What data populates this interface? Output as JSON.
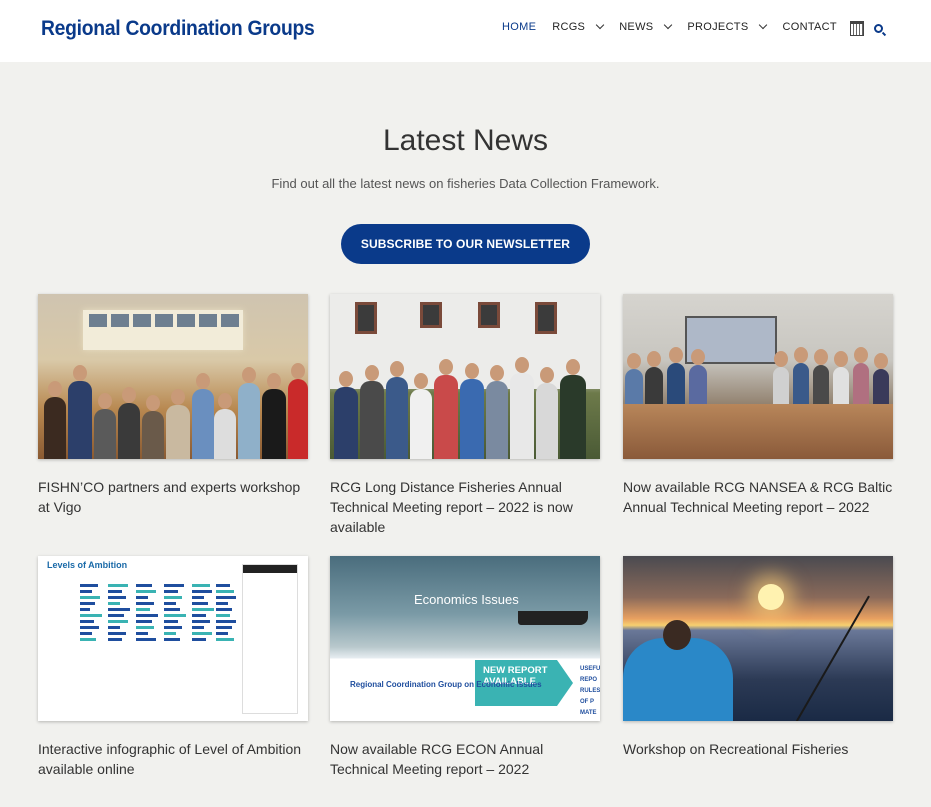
{
  "header": {
    "logo": "Regional Coordination Groups",
    "nav": [
      {
        "label": "HOME",
        "active": true,
        "dropdown": false
      },
      {
        "label": "RCGS",
        "active": false,
        "dropdown": true
      },
      {
        "label": "NEWS",
        "active": false,
        "dropdown": true
      },
      {
        "label": "PROJECTS",
        "active": false,
        "dropdown": true
      },
      {
        "label": "CONTACT",
        "active": false,
        "dropdown": false
      }
    ],
    "icons": {
      "calendar": "calendar-icon",
      "search": "search-icon"
    }
  },
  "hero": {
    "title": "Latest News",
    "subtitle": "Find out all the latest news on fisheries Data Collection Framework.",
    "cta": "SUBSCRIBE TO OUR NEWSLETTER"
  },
  "cards": [
    {
      "title": "FISHN’CO partners and experts workshop at Vigo"
    },
    {
      "title": "RCG Long Distance Fisheries Annual Technical Meeting report – 2022 is now available"
    },
    {
      "title": "Now available RCG NANSEA & RCG Baltic Annual Technical Meeting report – 2022"
    },
    {
      "title": "Interactive infographic of Level of Ambition available online",
      "image_text": {
        "heading": "Levels of Ambition"
      }
    },
    {
      "title": "Now available RCG ECON Annual Technical Meeting report – 2022",
      "image_text": {
        "banner": "Economics Issues",
        "badge": "NEW REPORT AVAILABLE",
        "group": "Regional Coordination Group on Economic Issues",
        "side": "USEFUL REPO RULES OF P MATE CONT"
      }
    },
    {
      "title": "Workshop on Recreational Fisheries"
    }
  ],
  "colors": {
    "brand": "#0a3a8a",
    "background": "#f1f1ee",
    "accent_teal": "#3ab3b3"
  }
}
